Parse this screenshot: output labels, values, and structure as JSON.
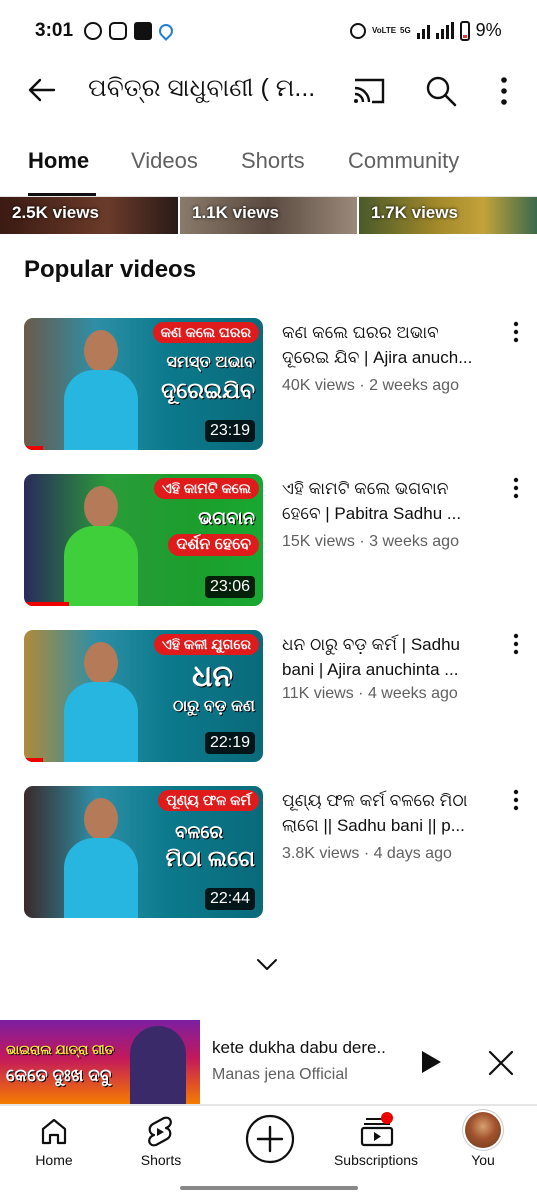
{
  "status": {
    "time": "3:01",
    "network_tag": "VoLTE",
    "net_type": "5G",
    "battery": "9%"
  },
  "header": {
    "title": "ପବିତ୍ର ସାଧୁବାଣୀ ( ମ..."
  },
  "tabs": [
    {
      "label": "Home",
      "active": true
    },
    {
      "label": "Videos",
      "active": false
    },
    {
      "label": "Shorts",
      "active": false
    },
    {
      "label": "Community",
      "active": false
    }
  ],
  "shorts_strip": [
    {
      "views": "2.5K views"
    },
    {
      "views": "1.1K views"
    },
    {
      "views": "1.7K views"
    }
  ],
  "section_title": "Popular videos",
  "videos": [
    {
      "title_line1": "କଣ କଲେ ଘରର ଅଭାବ",
      "title_line2": "ଦୂରେଇ ଯିବ | Ajira anuch...",
      "meta": "40K views · 2 weeks ago",
      "duration": "23:19",
      "thumb_caption": "କଣ କଲେ ଘରର",
      "thumb_big1": "ସମସ୍ତ ଅଭାବ",
      "thumb_big2": "ଦୂରେଇଯିବ",
      "watched": 0.08
    },
    {
      "title_line1": "ଏହି କାମଟି କଲେ ଭଗବାନ",
      "title_line2": "ହେବେ | Pabitra Sadhu ...",
      "meta": "15K views · 3 weeks ago",
      "duration": "23:06",
      "thumb_caption": "ଏହି କାମଟି କଲେ",
      "thumb_big1": "ଭଗବାନ",
      "thumb_big2": "ଦର୍ଶନ ହେବେ",
      "watched": 0.19
    },
    {
      "title_line1": "ଧନ ଠାରୁ ବଡ଼ କର୍ମ | Sadhu",
      "title_line2": "bani | Ajira anuchinta ...",
      "meta": "11K views · 4 weeks ago",
      "duration": "22:19",
      "thumb_caption": "ଏହି କଳୀ ଯୁଗରେ",
      "thumb_big1": "ଧନ",
      "thumb_big2": "ଠାରୁ ବଡ଼ କଣ",
      "watched": 0.08
    },
    {
      "title_line1": "ପୂଣ୍ୟ ଫଳ କର୍ମ ବଳରେ ମିଠା",
      "title_line2": "ଲାଗେ || Sadhu bani || p...",
      "meta": "3.8K views · 4 days ago",
      "duration": "22:44",
      "thumb_caption": "ପୂଣ୍ୟ ଫଳ କର୍ମ",
      "thumb_big1": "ବଳରେ",
      "thumb_big2": "ମିଠା ଲଗେ",
      "watched": 0
    }
  ],
  "mini_player": {
    "title": "kete dukha dabu dere..",
    "channel": "Manas jena Official",
    "thumb_text1": "ଭାଇରାଲ ଯାତ୍ରା ଗୀତ",
    "thumb_text2": "କେତେ ଦୁଃଖ ଦବୁ"
  },
  "bottom_nav": [
    {
      "label": "Home",
      "icon": "home-icon"
    },
    {
      "label": "Shorts",
      "icon": "shorts-icon"
    },
    {
      "label": "",
      "icon": "create-icon"
    },
    {
      "label": "Subscriptions",
      "icon": "subscriptions-icon"
    },
    {
      "label": "You",
      "icon": "avatar"
    }
  ],
  "colors": {
    "accent_red": "#ff0000",
    "thumb_teal": "#0b7a8c",
    "thumb_green": "#1c9e2d"
  }
}
